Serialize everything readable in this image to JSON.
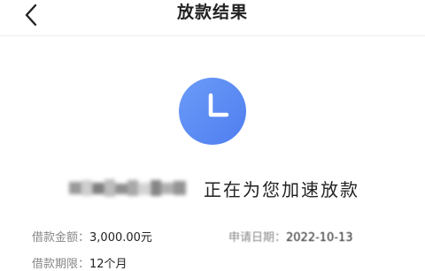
{
  "header": {
    "title": "放款结果"
  },
  "status": {
    "masked_name": "",
    "message": "正在为您加速放款",
    "icon": "clock-icon",
    "accent_color": "#5b8df5"
  },
  "details": {
    "amount_label": "借款金额：",
    "amount_value": "3,000.00元",
    "date_label": "申请日期：",
    "date_value": "2022-10-13",
    "term_label": "借款期限：",
    "term_value": "12个月"
  }
}
